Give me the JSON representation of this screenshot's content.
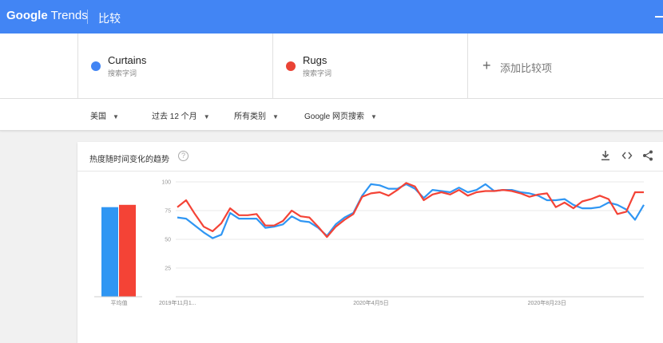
{
  "header": {
    "logo_google": "Google",
    "logo_trends": "Trends",
    "page_title": "比较"
  },
  "terms": [
    {
      "name": "Curtains",
      "subtitle": "搜索字词",
      "color": "#4285f4"
    },
    {
      "name": "Rugs",
      "subtitle": "搜索字词",
      "color": "#ea4335"
    }
  ],
  "add_term": {
    "label": "添加比较项",
    "icon": "plus-icon"
  },
  "filters": [
    {
      "label": "美国"
    },
    {
      "label": "过去 12 个月"
    },
    {
      "label": "所有类别"
    },
    {
      "label": "Google 网页搜索"
    }
  ],
  "card": {
    "title": "热度随时间变化的趋势",
    "help_icon": "?",
    "actions": [
      "download-icon",
      "embed-icon",
      "share-icon"
    ]
  },
  "chart_data": {
    "type": "line",
    "average_label": "平均值",
    "averages": [
      {
        "name": "Curtains",
        "value": 78,
        "color": "#2f96f3"
      },
      {
        "name": "Rugs",
        "value": 80,
        "color": "#f44336"
      }
    ],
    "yticks": [
      25,
      50,
      75,
      100
    ],
    "ylim": [
      0,
      100
    ],
    "xlabels": [
      "2019年11月1...",
      "2020年4月5日",
      "2020年8月23日"
    ],
    "xlabel_indices": [
      0,
      22,
      42
    ],
    "series": [
      {
        "name": "Curtains",
        "color": "#2f96f3",
        "values": [
          69,
          68,
          62,
          56,
          51,
          54,
          73,
          68,
          68,
          68,
          60,
          61,
          63,
          70,
          66,
          65,
          60,
          53,
          63,
          69,
          73,
          88,
          98,
          97,
          94,
          94,
          98,
          94,
          86,
          93,
          92,
          91,
          95,
          91,
          93,
          98,
          92,
          93,
          93,
          91,
          90,
          88,
          84,
          84,
          85,
          80,
          77,
          77,
          78,
          82,
          80,
          76,
          67,
          80
        ]
      },
      {
        "name": "Rugs",
        "color": "#f44336",
        "values": [
          78,
          84,
          72,
          61,
          57,
          64,
          77,
          71,
          71,
          72,
          62,
          62,
          66,
          75,
          70,
          69,
          61,
          52,
          61,
          67,
          72,
          87,
          90,
          91,
          88,
          93,
          99,
          96,
          84,
          89,
          91,
          89,
          93,
          88,
          91,
          92,
          92,
          93,
          92,
          90,
          87,
          89,
          90,
          78,
          82,
          77,
          83,
          85,
          88,
          85,
          72,
          74,
          91,
          91
        ]
      }
    ]
  }
}
